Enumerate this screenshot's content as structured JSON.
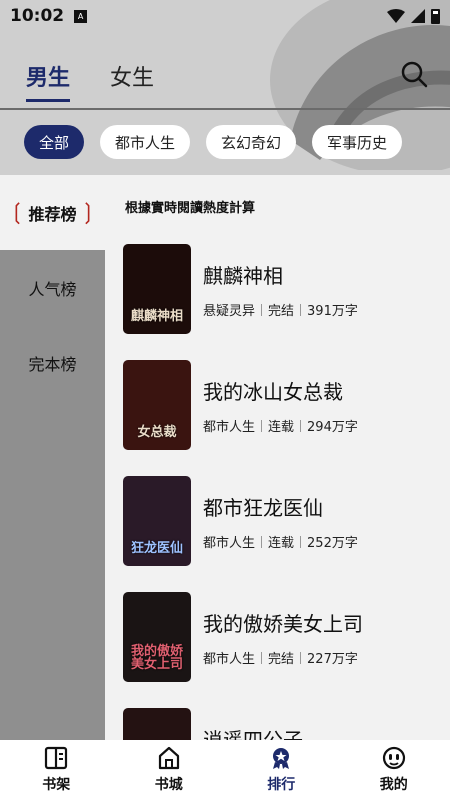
{
  "status": {
    "time": "10:02",
    "a_badge": "A"
  },
  "gender_tabs": [
    {
      "label": "男生",
      "active": true
    },
    {
      "label": "女生",
      "active": false
    }
  ],
  "icons": {
    "search": "search-icon",
    "wifi": "wifi-icon",
    "signal": "signal-icon",
    "battery": "battery-icon"
  },
  "categories": [
    {
      "label": "全部",
      "active": true
    },
    {
      "label": "都市人生",
      "active": false
    },
    {
      "label": "玄幻奇幻",
      "active": false
    },
    {
      "label": "军事历史",
      "active": false
    }
  ],
  "sidebar": {
    "items": [
      {
        "label": "推荐榜",
        "active": true
      },
      {
        "label": "人气榜",
        "active": false
      },
      {
        "label": "完本榜",
        "active": false
      }
    ]
  },
  "list": {
    "title": "根據實時閱讀熱度計算",
    "books": [
      {
        "title": "麒麟神相",
        "genre": "悬疑灵异",
        "status": "完结",
        "words": "391万字",
        "cover_text": "麒麟神相",
        "cover_color": "#1c0c0a"
      },
      {
        "title": "我的冰山女总裁",
        "genre": "都市人生",
        "status": "连载",
        "words": "294万字",
        "cover_text": "女总裁",
        "cover_color": "#3a1410"
      },
      {
        "title": "都市狂龙医仙",
        "genre": "都市人生",
        "status": "连载",
        "words": "252万字",
        "cover_text": "狂龙医仙",
        "cover_color": "#2a1a28"
      },
      {
        "title": "我的傲娇美女上司",
        "genre": "都市人生",
        "status": "完结",
        "words": "227万字",
        "cover_text": "我的傲娇美女上司",
        "cover_color": "#1a1414"
      },
      {
        "title": "逍遥四公子",
        "genre": "",
        "status": "",
        "words": "",
        "cover_text": "",
        "cover_color": "#241212"
      }
    ]
  },
  "bottom_nav": [
    {
      "label": "书架",
      "icon": "bookshelf-icon",
      "active": false
    },
    {
      "label": "书城",
      "icon": "bookstore-icon",
      "active": false
    },
    {
      "label": "排行",
      "icon": "ranking-icon",
      "active": true
    },
    {
      "label": "我的",
      "icon": "profile-icon",
      "active": false
    }
  ],
  "colors": {
    "accent": "#1d2a6b",
    "laurel": "#b3271f"
  }
}
